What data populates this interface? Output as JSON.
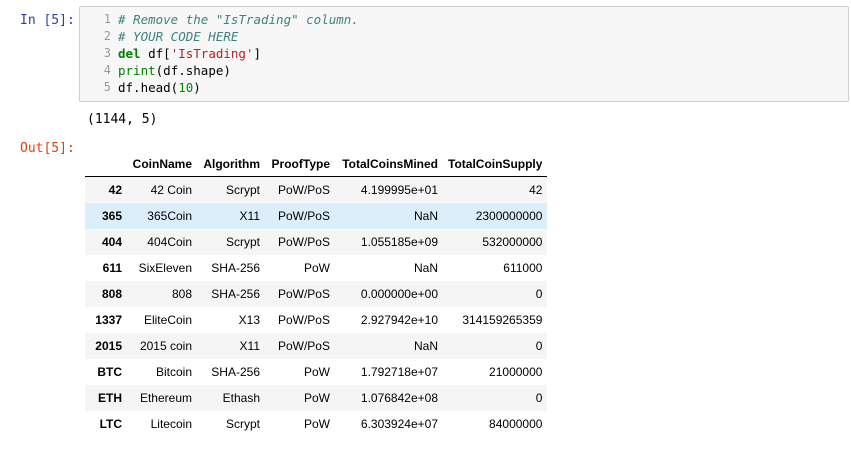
{
  "input_prompt": "In [5]:",
  "output_prompt": "Out[5]:",
  "code_lines": [
    {
      "num": "1",
      "parts": [
        {
          "cls": "cm-comment",
          "text": "# Remove the \"IsTrading\" column."
        }
      ]
    },
    {
      "num": "2",
      "parts": [
        {
          "cls": "cm-comment",
          "text": "# YOUR CODE HERE"
        }
      ]
    },
    {
      "num": "3",
      "parts": [
        {
          "cls": "cm-keyword",
          "text": "del"
        },
        {
          "cls": "",
          "text": " df["
        },
        {
          "cls": "cm-string",
          "text": "'IsTrading'"
        },
        {
          "cls": "",
          "text": "]"
        }
      ]
    },
    {
      "num": "4",
      "parts": [
        {
          "cls": "cm-builtin",
          "text": "print"
        },
        {
          "cls": "",
          "text": "(df.shape)"
        }
      ]
    },
    {
      "num": "5",
      "parts": [
        {
          "cls": "",
          "text": "df.head("
        },
        {
          "cls": "cm-number",
          "text": "10"
        },
        {
          "cls": "",
          "text": ")"
        }
      ]
    }
  ],
  "stdout": "(1144, 5)",
  "table": {
    "columns": [
      "CoinName",
      "Algorithm",
      "ProofType",
      "TotalCoinsMined",
      "TotalCoinSupply"
    ],
    "rows": [
      {
        "index": "42",
        "CoinName": "42 Coin",
        "Algorithm": "Scrypt",
        "ProofType": "PoW/PoS",
        "TotalCoinsMined": "4.199995e+01",
        "TotalCoinSupply": "42"
      },
      {
        "index": "365",
        "CoinName": "365Coin",
        "Algorithm": "X11",
        "ProofType": "PoW/PoS",
        "TotalCoinsMined": "NaN",
        "TotalCoinSupply": "2300000000",
        "highlighted": true
      },
      {
        "index": "404",
        "CoinName": "404Coin",
        "Algorithm": "Scrypt",
        "ProofType": "PoW/PoS",
        "TotalCoinsMined": "1.055185e+09",
        "TotalCoinSupply": "532000000"
      },
      {
        "index": "611",
        "CoinName": "SixEleven",
        "Algorithm": "SHA-256",
        "ProofType": "PoW",
        "TotalCoinsMined": "NaN",
        "TotalCoinSupply": "611000"
      },
      {
        "index": "808",
        "CoinName": "808",
        "Algorithm": "SHA-256",
        "ProofType": "PoW/PoS",
        "TotalCoinsMined": "0.000000e+00",
        "TotalCoinSupply": "0"
      },
      {
        "index": "1337",
        "CoinName": "EliteCoin",
        "Algorithm": "X13",
        "ProofType": "PoW/PoS",
        "TotalCoinsMined": "2.927942e+10",
        "TotalCoinSupply": "314159265359"
      },
      {
        "index": "2015",
        "CoinName": "2015 coin",
        "Algorithm": "X11",
        "ProofType": "PoW/PoS",
        "TotalCoinsMined": "NaN",
        "TotalCoinSupply": "0"
      },
      {
        "index": "BTC",
        "CoinName": "Bitcoin",
        "Algorithm": "SHA-256",
        "ProofType": "PoW",
        "TotalCoinsMined": "1.792718e+07",
        "TotalCoinSupply": "21000000"
      },
      {
        "index": "ETH",
        "CoinName": "Ethereum",
        "Algorithm": "Ethash",
        "ProofType": "PoW",
        "TotalCoinsMined": "1.076842e+08",
        "TotalCoinSupply": "0"
      },
      {
        "index": "LTC",
        "CoinName": "Litecoin",
        "Algorithm": "Scrypt",
        "ProofType": "PoW",
        "TotalCoinsMined": "6.303924e+07",
        "TotalCoinSupply": "84000000"
      }
    ]
  }
}
